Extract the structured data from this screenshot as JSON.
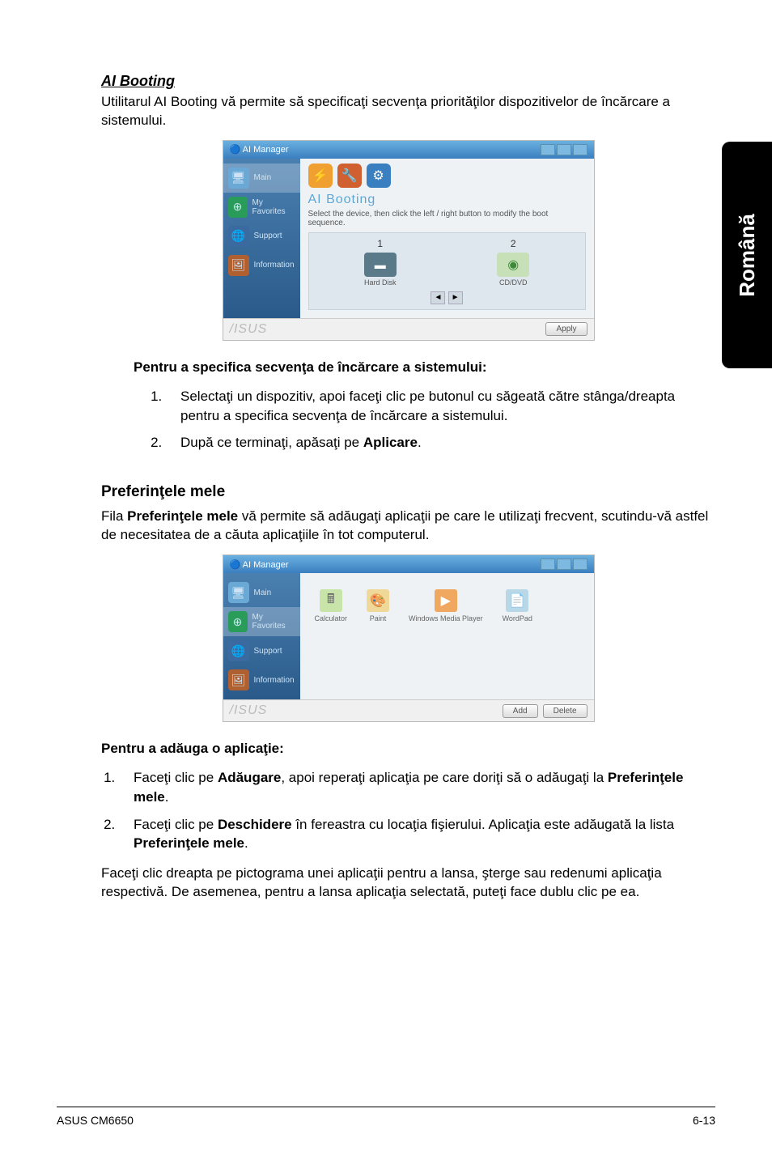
{
  "sideTab": "Română",
  "section1": {
    "heading": "AI Booting",
    "intro": "Utilitarul AI Booting vă permite să specificaţi secvenţa priorităţilor dispozitivelor de încărcare a sistemului.",
    "subheading": "Pentru a specifica secvenţa de încărcare a sistemului:",
    "steps": [
      "Selectaţi un dispozitiv, apoi faceţi clic pe butonul cu săgeată către stânga/dreapta pentru a specifica secvenţa de încărcare a sistemului.",
      "După ce terminaţi, apăsaţi pe <b>Aplicare</b>."
    ]
  },
  "section2": {
    "heading": "Preferinţele mele",
    "intro_pre": "Fila ",
    "intro_bold": "Preferinţele mele",
    "intro_post": " vă permite să adăugaţi aplicaţii pe care le utilizaţi frecvent, scutindu-vă astfel de necesitatea de a căuta aplicaţiile în tot computerul.",
    "subheading": "Pentru a adăuga o aplicaţie:",
    "steps": [
      "Faceţi clic pe <b>Adăugare</b>, apoi reperaţi aplicaţia pe care doriţi să o adăugaţi la <b>Preferinţele mele</b>.",
      "Faceţi clic pe <b>Deschidere</b> în fereastra cu locaţia fişierului. Aplicaţia este adăugată la lista <b>Preferinţele mele</b>."
    ],
    "closing": "Faceţi clic dreapta pe pictograma unei aplicaţii pentru a lansa, şterge sau redenumi aplicaţia respectivă. De asemenea, pentru a lansa aplicaţia selectată, puteţi face dublu clic pe ea."
  },
  "mock": {
    "appTitle": "AI Manager",
    "side": {
      "main": "Main",
      "fav": "My Favorites",
      "support": "Support",
      "info": "Information"
    },
    "panel1": {
      "title": "AI Booting",
      "desc": "Select the device, then click the left / right button to modify the boot sequence.",
      "num1": "1",
      "num2": "2",
      "dev1": "Hard Disk",
      "dev2": "CD/DVD"
    },
    "panel2": {
      "items": [
        "Calculator",
        "Paint",
        "Windows Media Player",
        "WordPad"
      ]
    },
    "brand": "/ISUS",
    "buttons": {
      "apply": "Apply",
      "add": "Add",
      "delete": "Delete"
    }
  },
  "footer": {
    "left": "ASUS CM6650",
    "right": "6-13"
  }
}
